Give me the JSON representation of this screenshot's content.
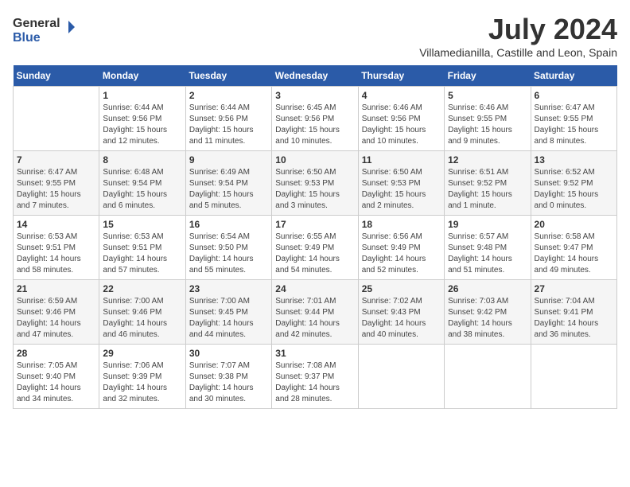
{
  "logo": {
    "general": "General",
    "blue": "Blue"
  },
  "title": "July 2024",
  "subtitle": "Villamedianilla, Castille and Leon, Spain",
  "weekdays": [
    "Sunday",
    "Monday",
    "Tuesday",
    "Wednesday",
    "Thursday",
    "Friday",
    "Saturday"
  ],
  "weeks": [
    [
      {
        "day": "",
        "info": ""
      },
      {
        "day": "1",
        "info": "Sunrise: 6:44 AM\nSunset: 9:56 PM\nDaylight: 15 hours\nand 12 minutes."
      },
      {
        "day": "2",
        "info": "Sunrise: 6:44 AM\nSunset: 9:56 PM\nDaylight: 15 hours\nand 11 minutes."
      },
      {
        "day": "3",
        "info": "Sunrise: 6:45 AM\nSunset: 9:56 PM\nDaylight: 15 hours\nand 10 minutes."
      },
      {
        "day": "4",
        "info": "Sunrise: 6:46 AM\nSunset: 9:56 PM\nDaylight: 15 hours\nand 10 minutes."
      },
      {
        "day": "5",
        "info": "Sunrise: 6:46 AM\nSunset: 9:55 PM\nDaylight: 15 hours\nand 9 minutes."
      },
      {
        "day": "6",
        "info": "Sunrise: 6:47 AM\nSunset: 9:55 PM\nDaylight: 15 hours\nand 8 minutes."
      }
    ],
    [
      {
        "day": "7",
        "info": "Sunrise: 6:47 AM\nSunset: 9:55 PM\nDaylight: 15 hours\nand 7 minutes."
      },
      {
        "day": "8",
        "info": "Sunrise: 6:48 AM\nSunset: 9:54 PM\nDaylight: 15 hours\nand 6 minutes."
      },
      {
        "day": "9",
        "info": "Sunrise: 6:49 AM\nSunset: 9:54 PM\nDaylight: 15 hours\nand 5 minutes."
      },
      {
        "day": "10",
        "info": "Sunrise: 6:50 AM\nSunset: 9:53 PM\nDaylight: 15 hours\nand 3 minutes."
      },
      {
        "day": "11",
        "info": "Sunrise: 6:50 AM\nSunset: 9:53 PM\nDaylight: 15 hours\nand 2 minutes."
      },
      {
        "day": "12",
        "info": "Sunrise: 6:51 AM\nSunset: 9:52 PM\nDaylight: 15 hours\nand 1 minute."
      },
      {
        "day": "13",
        "info": "Sunrise: 6:52 AM\nSunset: 9:52 PM\nDaylight: 15 hours\nand 0 minutes."
      }
    ],
    [
      {
        "day": "14",
        "info": "Sunrise: 6:53 AM\nSunset: 9:51 PM\nDaylight: 14 hours\nand 58 minutes."
      },
      {
        "day": "15",
        "info": "Sunrise: 6:53 AM\nSunset: 9:51 PM\nDaylight: 14 hours\nand 57 minutes."
      },
      {
        "day": "16",
        "info": "Sunrise: 6:54 AM\nSunset: 9:50 PM\nDaylight: 14 hours\nand 55 minutes."
      },
      {
        "day": "17",
        "info": "Sunrise: 6:55 AM\nSunset: 9:49 PM\nDaylight: 14 hours\nand 54 minutes."
      },
      {
        "day": "18",
        "info": "Sunrise: 6:56 AM\nSunset: 9:49 PM\nDaylight: 14 hours\nand 52 minutes."
      },
      {
        "day": "19",
        "info": "Sunrise: 6:57 AM\nSunset: 9:48 PM\nDaylight: 14 hours\nand 51 minutes."
      },
      {
        "day": "20",
        "info": "Sunrise: 6:58 AM\nSunset: 9:47 PM\nDaylight: 14 hours\nand 49 minutes."
      }
    ],
    [
      {
        "day": "21",
        "info": "Sunrise: 6:59 AM\nSunset: 9:46 PM\nDaylight: 14 hours\nand 47 minutes."
      },
      {
        "day": "22",
        "info": "Sunrise: 7:00 AM\nSunset: 9:46 PM\nDaylight: 14 hours\nand 46 minutes."
      },
      {
        "day": "23",
        "info": "Sunrise: 7:00 AM\nSunset: 9:45 PM\nDaylight: 14 hours\nand 44 minutes."
      },
      {
        "day": "24",
        "info": "Sunrise: 7:01 AM\nSunset: 9:44 PM\nDaylight: 14 hours\nand 42 minutes."
      },
      {
        "day": "25",
        "info": "Sunrise: 7:02 AM\nSunset: 9:43 PM\nDaylight: 14 hours\nand 40 minutes."
      },
      {
        "day": "26",
        "info": "Sunrise: 7:03 AM\nSunset: 9:42 PM\nDaylight: 14 hours\nand 38 minutes."
      },
      {
        "day": "27",
        "info": "Sunrise: 7:04 AM\nSunset: 9:41 PM\nDaylight: 14 hours\nand 36 minutes."
      }
    ],
    [
      {
        "day": "28",
        "info": "Sunrise: 7:05 AM\nSunset: 9:40 PM\nDaylight: 14 hours\nand 34 minutes."
      },
      {
        "day": "29",
        "info": "Sunrise: 7:06 AM\nSunset: 9:39 PM\nDaylight: 14 hours\nand 32 minutes."
      },
      {
        "day": "30",
        "info": "Sunrise: 7:07 AM\nSunset: 9:38 PM\nDaylight: 14 hours\nand 30 minutes."
      },
      {
        "day": "31",
        "info": "Sunrise: 7:08 AM\nSunset: 9:37 PM\nDaylight: 14 hours\nand 28 minutes."
      },
      {
        "day": "",
        "info": ""
      },
      {
        "day": "",
        "info": ""
      },
      {
        "day": "",
        "info": ""
      }
    ]
  ]
}
